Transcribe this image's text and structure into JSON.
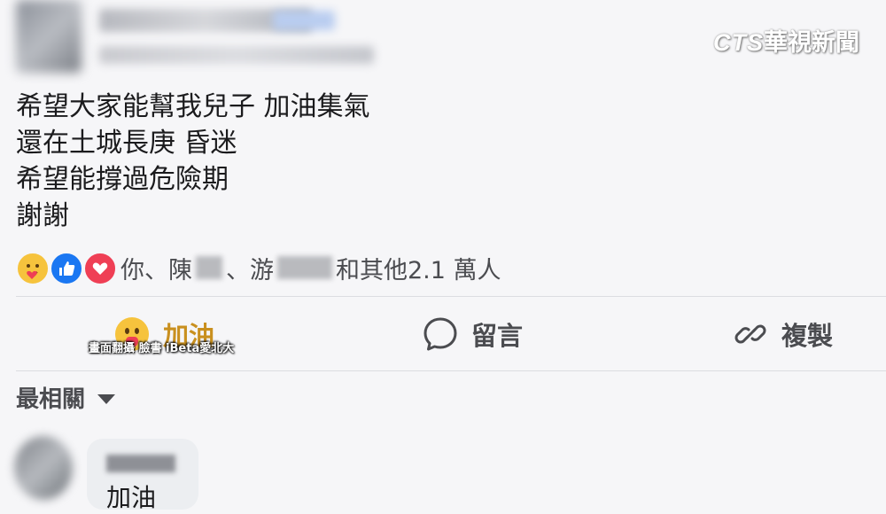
{
  "watermark": {
    "cts": "CTS",
    "brand": "華視新聞"
  },
  "post": {
    "lines": [
      "希望大家能幫我兒子 加油集氣",
      "還在土城長庚 昏迷",
      "希望能撐過危險期",
      "謝謝"
    ]
  },
  "reactions": {
    "icons": [
      "care-icon",
      "like-icon",
      "love-icon"
    ],
    "text_you": "你、陳",
    "text_sep": "、游",
    "text_rest": "和其他2.1 萬人",
    "colors": {
      "care": "#f6c33d",
      "like": "#1a77f2",
      "love": "#ef3f55"
    }
  },
  "actions": {
    "cheer_label": "加油",
    "comment_label": "留言",
    "copy_label": "複製"
  },
  "caption": "畫面翻攝 臉書 iBeta愛北大",
  "sort": {
    "label": "最相關"
  },
  "comment": {
    "text": "加油"
  }
}
